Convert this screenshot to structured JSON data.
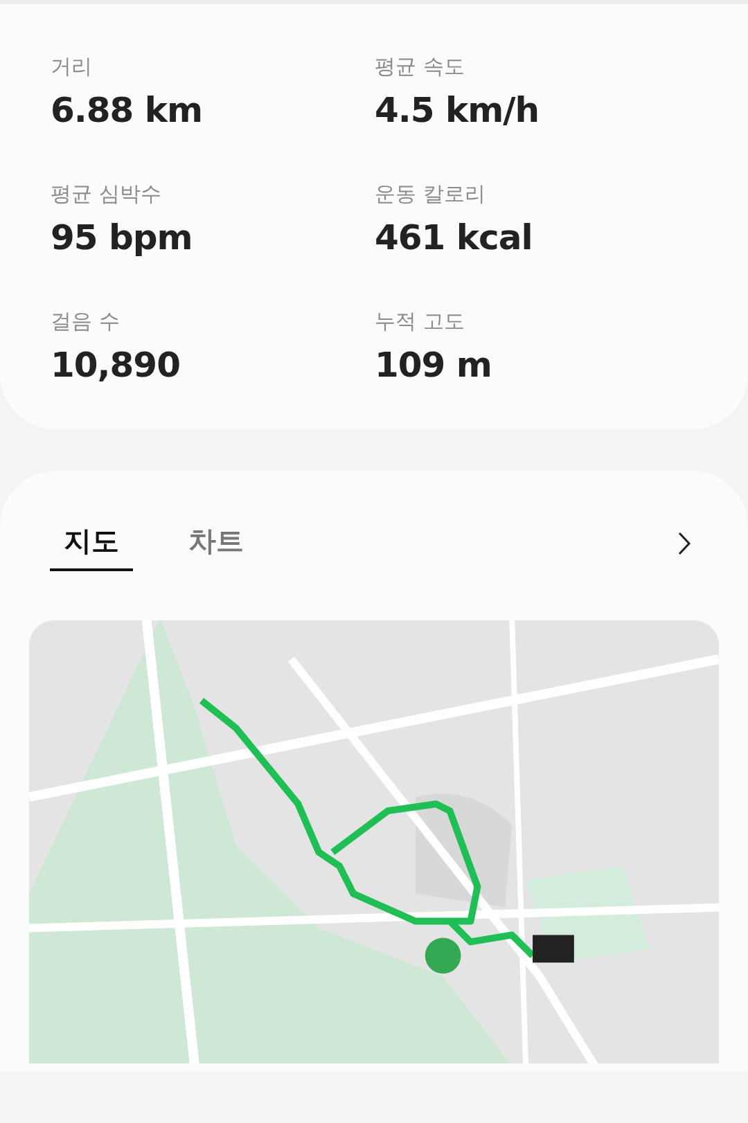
{
  "stats": [
    {
      "label": "거리",
      "value": "6.88 km"
    },
    {
      "label": "평균 속도",
      "value": "4.5 km/h"
    },
    {
      "label": "평균 심박수",
      "value": "95 bpm"
    },
    {
      "label": "운동 칼로리",
      "value": "461 kcal"
    },
    {
      "label": "걸음 수",
      "value": "10,890"
    },
    {
      "label": "누적 고도",
      "value": "109 m"
    }
  ],
  "tabs": [
    {
      "label": "지도",
      "selected": true
    },
    {
      "label": "차트",
      "selected": false
    }
  ]
}
